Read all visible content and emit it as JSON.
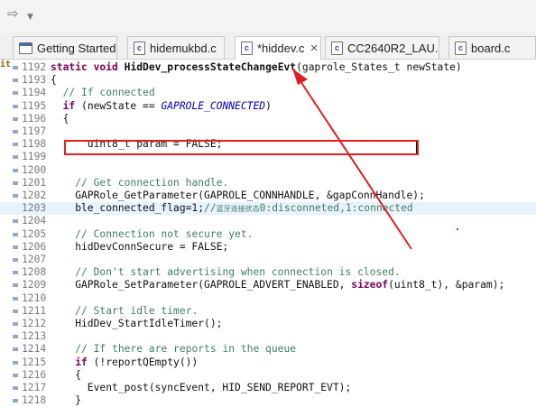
{
  "toolbar": {
    "forward_icon": "forward-arrow-icon",
    "dropdown_icon": "chevron-down-icon"
  },
  "tabs": [
    {
      "label": "Getting Started",
      "icon": "window-icon",
      "active": false
    },
    {
      "label": "hidemukbd.c",
      "icon": "c-file-icon",
      "active": false
    },
    {
      "label": "*hiddev.c",
      "icon": "c-file-icon",
      "active": true,
      "close": "✕"
    },
    {
      "label": "CC2640R2_LAU...",
      "icon": "c-file-icon",
      "active": false
    },
    {
      "label": "board.c",
      "icon": "c-file-icon",
      "active": false
    }
  ],
  "editor": {
    "left_marker": "it",
    "current_line": "1203",
    "lines": [
      {
        "num": "1192",
        "text": "static void HidDev_processStateChangeEvt(gaprole_States_t newState)"
      },
      {
        "num": "1193",
        "text": "{"
      },
      {
        "num": "1194",
        "text": "  // If connected"
      },
      {
        "num": "1195",
        "text": "  if (newState == GAPROLE_CONNECTED)"
      },
      {
        "num": "1196",
        "text": "  {"
      },
      {
        "num": "1197",
        "text": ""
      },
      {
        "num": "1198",
        "text": "      uint8_t param = FALSE;"
      },
      {
        "num": "1199",
        "text": ""
      },
      {
        "num": "1200",
        "text": ""
      },
      {
        "num": "1201",
        "text": "    // Get connection handle."
      },
      {
        "num": "1202",
        "text": "    GAPRole_GetParameter(GAPROLE_CONNHANDLE, &gapConnHandle);"
      },
      {
        "num": "1203",
        "text": "    ble_connected_flag=1;//蓝牙连接状态0:disconneted,1:connected"
      },
      {
        "num": "1204",
        "text": ""
      },
      {
        "num": "1205",
        "text": "    // Connection not secure yet."
      },
      {
        "num": "1206",
        "text": "    hidDevConnSecure = FALSE;"
      },
      {
        "num": "1207",
        "text": ""
      },
      {
        "num": "1208",
        "text": "    // Don't start advertising when connection is closed."
      },
      {
        "num": "1209",
        "text": "    GAPRole_SetParameter(GAPROLE_ADVERT_ENABLED, sizeof(uint8_t), &param);"
      },
      {
        "num": "1210",
        "text": ""
      },
      {
        "num": "1211",
        "text": "    // Start idle timer."
      },
      {
        "num": "1212",
        "text": "    HidDev_StartIdleTimer();"
      },
      {
        "num": "1213",
        "text": ""
      },
      {
        "num": "1214",
        "text": "    // If there are reports in the queue"
      },
      {
        "num": "1215",
        "text": "    if (!reportQEmpty())"
      },
      {
        "num": "1216",
        "text": "    {"
      },
      {
        "num": "1217",
        "text": "      Event_post(syncEvent, HID_SEND_REPORT_EVT);"
      },
      {
        "num": "1218",
        "text": "    }"
      }
    ]
  },
  "annotation": {
    "color": "#e02020",
    "highlighted_line": "1203"
  },
  "colors": {
    "keyword": "#7f0055",
    "comment": "#3f7f5f",
    "constant": "#0000c0",
    "current_line_bg": "#e8f2fe"
  }
}
